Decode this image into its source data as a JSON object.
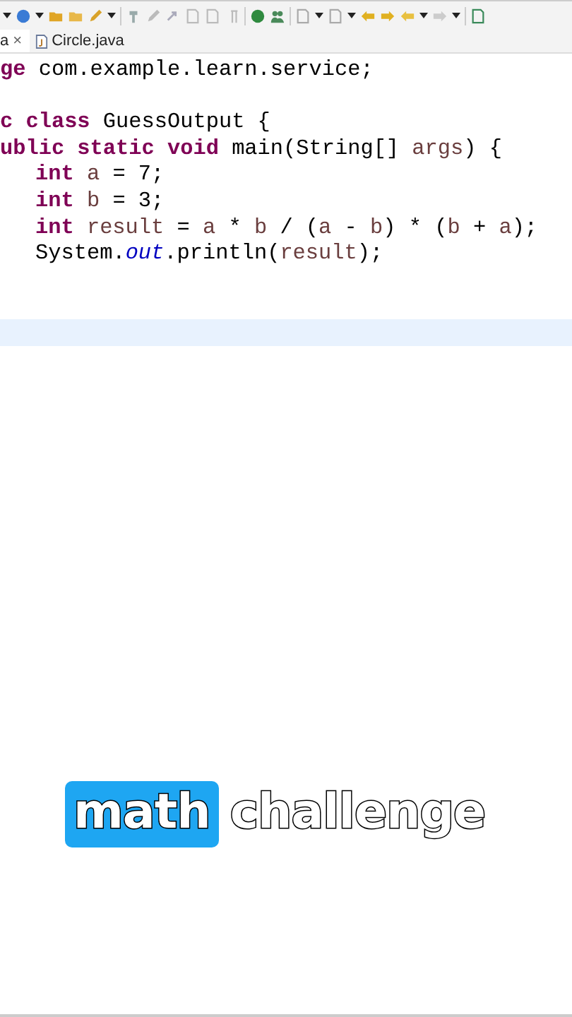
{
  "tabs": [
    {
      "label": "a",
      "selected": true,
      "close_glyph": "×"
    },
    {
      "label": "Circle.java",
      "selected": false
    }
  ],
  "code_lines": [
    {
      "kind": "top",
      "current": false,
      "tokens": [
        {
          "kind": "keyword",
          "text": "ge"
        },
        {
          "kind": "plain",
          "text": " com.example.learn.service;"
        }
      ]
    },
    {
      "kind": "blank",
      "current": false
    },
    {
      "kind": "top",
      "current": false,
      "tokens": [
        {
          "kind": "keyword",
          "text": "c class"
        },
        {
          "kind": "plain",
          "text": " GuessOutput {"
        }
      ]
    },
    {
      "kind": "top",
      "current": false,
      "tokens": [
        {
          "kind": "keyword",
          "text": "ublic static void"
        },
        {
          "kind": "plain",
          "text": " main(String[] "
        },
        {
          "kind": "local",
          "text": "args"
        },
        {
          "kind": "plain",
          "text": ") {"
        }
      ]
    },
    {
      "kind": "body",
      "current": false,
      "tokens": [
        {
          "kind": "keyword",
          "text": "int"
        },
        {
          "kind": "local",
          "text": "a",
          "gap_before": true
        },
        {
          "kind": "plain",
          "text": " = 7;"
        }
      ]
    },
    {
      "kind": "body",
      "current": false,
      "tokens": [
        {
          "kind": "keyword",
          "text": "int"
        },
        {
          "kind": "local",
          "text": "b",
          "gap_before": true
        },
        {
          "kind": "plain",
          "text": " = 3;"
        }
      ]
    },
    {
      "kind": "body",
      "current": false,
      "tokens": [
        {
          "kind": "keyword",
          "text": "int"
        },
        {
          "kind": "local",
          "text": "result",
          "gap_before": true
        },
        {
          "kind": "plain",
          "text": " = "
        },
        {
          "kind": "local",
          "text": "a"
        },
        {
          "kind": "plain",
          "text": " * "
        },
        {
          "kind": "local",
          "text": "b"
        },
        {
          "kind": "plain",
          "text": " / ("
        },
        {
          "kind": "local",
          "text": "a"
        },
        {
          "kind": "plain",
          "text": " - "
        },
        {
          "kind": "local",
          "text": "b"
        },
        {
          "kind": "plain",
          "text": ") * ("
        },
        {
          "kind": "local",
          "text": "b"
        },
        {
          "kind": "plain",
          "text": " + "
        },
        {
          "kind": "local",
          "text": "a"
        },
        {
          "kind": "plain",
          "text": ");"
        }
      ]
    },
    {
      "kind": "body",
      "current": false,
      "tokens": [
        {
          "kind": "plain",
          "text": "System."
        },
        {
          "kind": "field",
          "text": "out"
        },
        {
          "kind": "plain",
          "text": ".println("
        },
        {
          "kind": "local",
          "text": "result"
        },
        {
          "kind": "plain",
          "text": ");"
        }
      ]
    },
    {
      "kind": "blank",
      "current": false
    },
    {
      "kind": "blank",
      "current": false
    },
    {
      "kind": "blank",
      "current": true
    }
  ],
  "caption": [
    {
      "text": "math",
      "highlighted": true
    },
    {
      "text": "challenge",
      "highlighted": false
    }
  ]
}
